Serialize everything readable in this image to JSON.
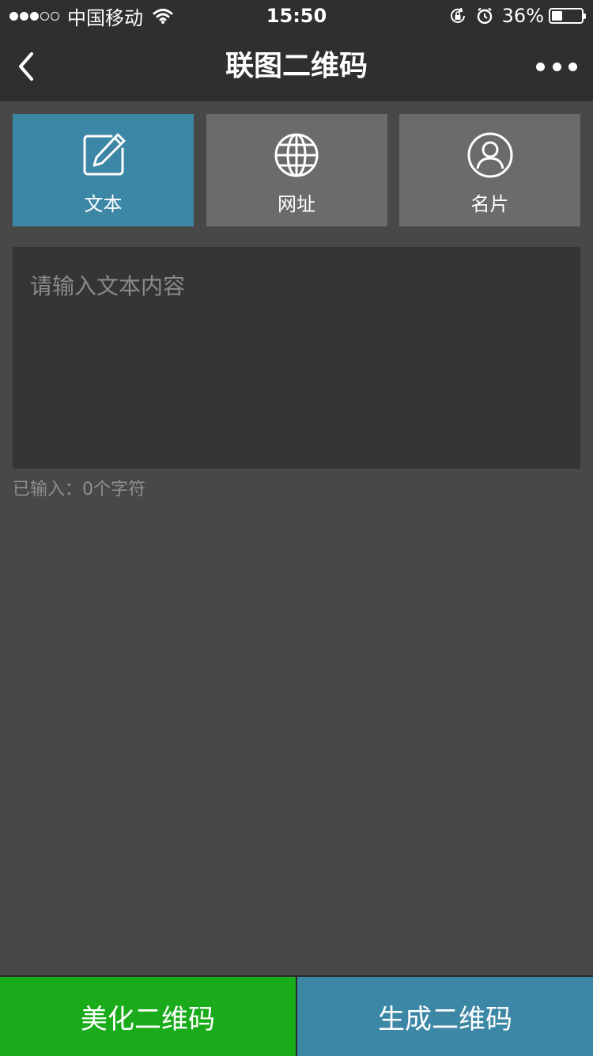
{
  "status_bar": {
    "carrier": "中国移动",
    "time": "15:50",
    "battery_pct": "36%",
    "battery_level": 0.36
  },
  "nav": {
    "title": "联图二维码",
    "back_icon": "chevron-left-icon",
    "more_icon": "more-dots-icon"
  },
  "tabs": [
    {
      "label": "文本",
      "icon": "edit-icon",
      "active": true
    },
    {
      "label": "网址",
      "icon": "globe-icon",
      "active": false
    },
    {
      "label": "名片",
      "icon": "user-icon",
      "active": false
    }
  ],
  "input": {
    "placeholder": "请输入文本内容",
    "value": ""
  },
  "char_count": "已输入：0个字符",
  "actions": {
    "beautify_label": "美化二维码",
    "generate_label": "生成二维码"
  },
  "colors": {
    "accent": "#3d87a6",
    "green": "#1aab1b",
    "background": "#484848",
    "bar": "#2f2f2f"
  }
}
